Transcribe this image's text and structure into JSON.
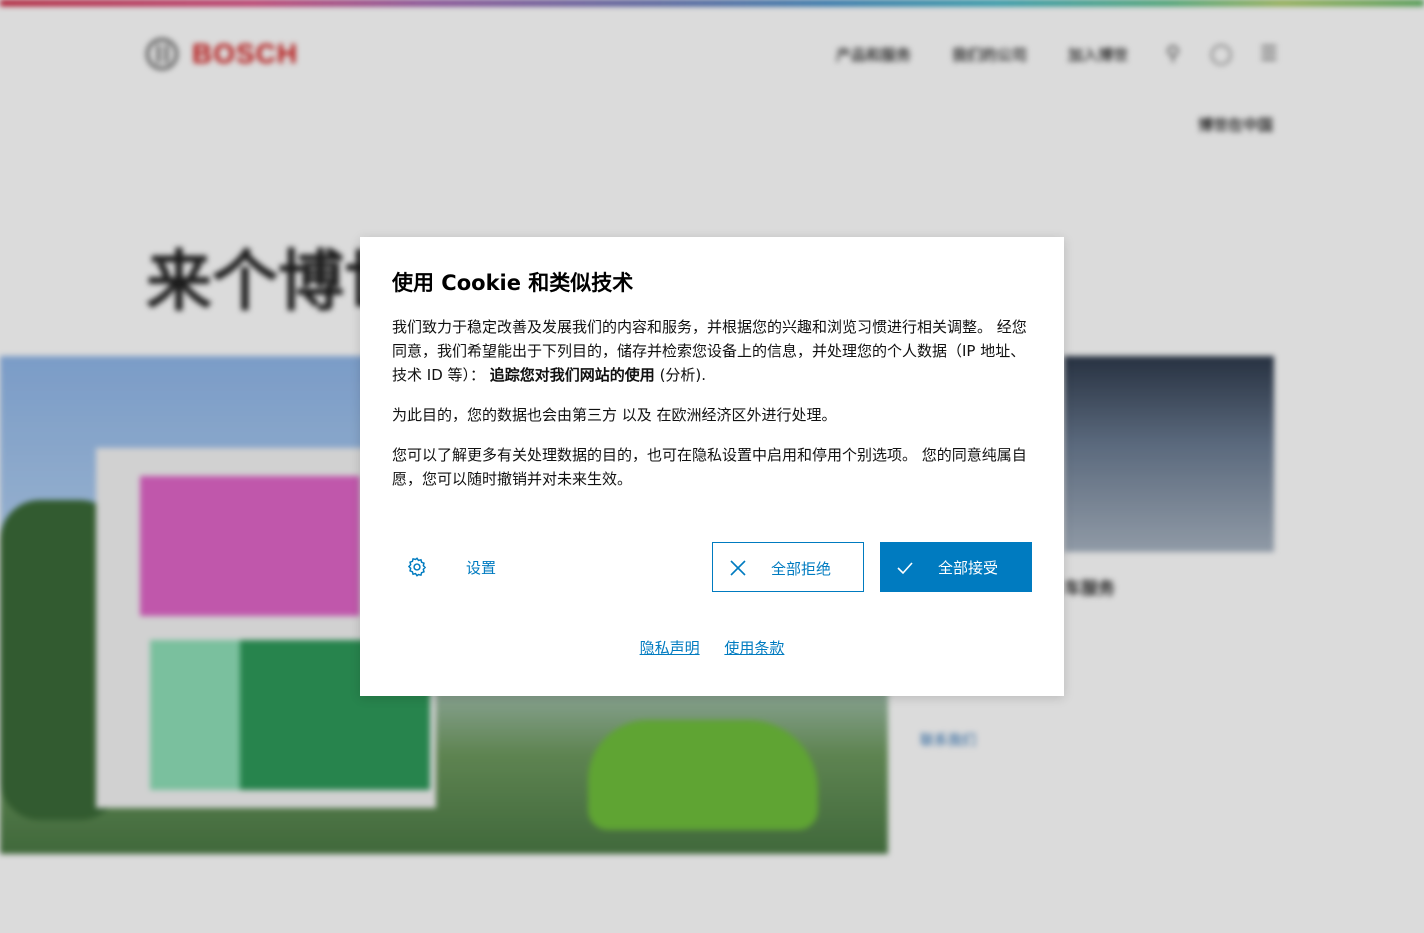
{
  "background": {
    "logo_text": "BOSCH",
    "nav": [
      "产品和服务",
      "我们的公司",
      "加入博世"
    ],
    "sub_link": "博世在中国",
    "hero_title": "来个博世",
    "side_caption": "车服务",
    "side_link": "联系我们"
  },
  "dialog": {
    "title": "使用 Cookie 和类似技术",
    "para1_a": "我们致力于稳定改善及发展我们的内容和服务，并根据您的兴趣和浏览习惯进行相关调整。 经您同意，我们希望能出于下列目的，储存并检索您设备上的信息，并处理您的个人数据（IP 地址、技术 ID 等）： ",
    "para1_bold": "追踪您对我们网站的使用",
    "para1_b": " (分析).",
    "para2": "为此目的，您的数据也会由第三方 以及 在欧洲经济区外进行处理。",
    "para3": "您可以了解更多有关处理数据的目的，也可在隐私设置中启用和停用个别选项。 您的同意纯属自愿，您可以随时撤销并对未来生效。",
    "settings_label": "设置",
    "reject_label": "全部拒绝",
    "accept_label": "全部接受",
    "privacy_link": "隐私声明",
    "terms_link": "使用条款"
  },
  "colors": {
    "accent": "#007bc0",
    "brand": "#d11a1a"
  },
  "icons": {
    "settings": "gear-icon",
    "reject": "close-icon",
    "accept": "checkmark-icon"
  }
}
